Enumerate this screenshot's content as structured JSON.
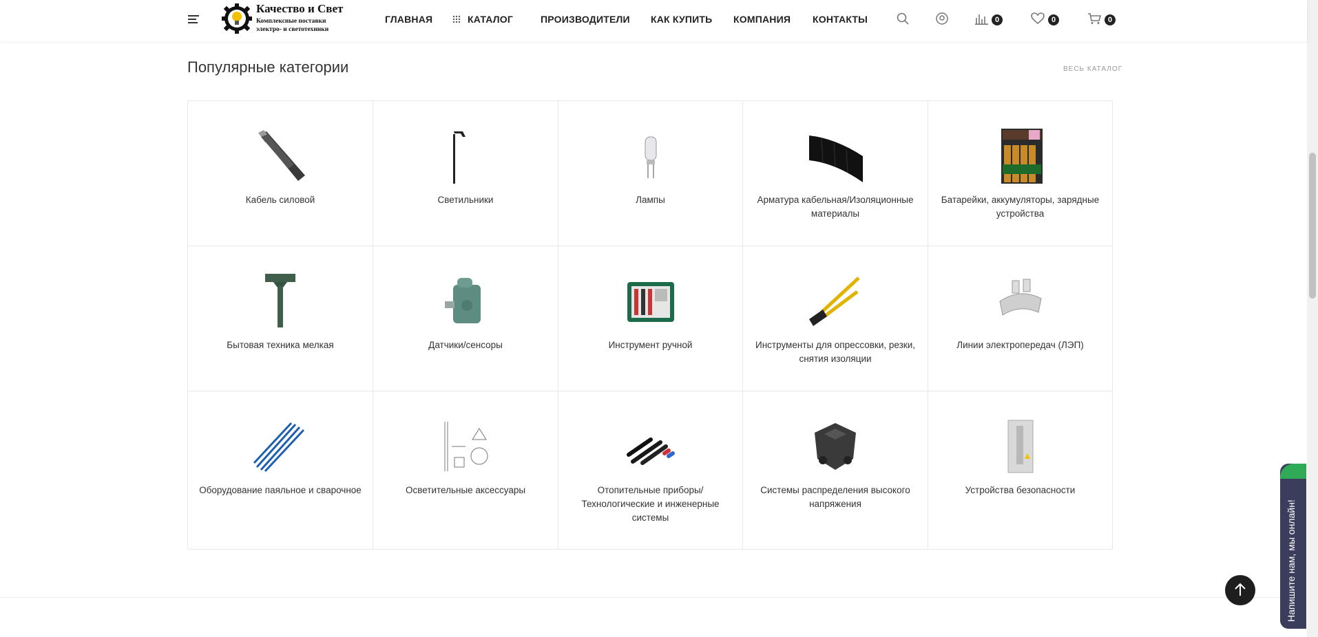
{
  "header": {
    "logo": {
      "title": "Качество и Свет",
      "subtitle_line1": "Комплексные поставки",
      "subtitle_line2": "электро- и светотехники"
    },
    "nav": [
      "ГЛАВНАЯ",
      "КАТАЛОГ",
      "ПРОИЗВОДИТЕЛИ",
      "КАК КУПИТЬ",
      "КОМПАНИЯ",
      "КОНТАКТЫ"
    ],
    "compare_count": "0",
    "favorites_count": "0",
    "cart_count": "0"
  },
  "section": {
    "title": "Популярные категории",
    "all_link": "ВЕСЬ КАТАЛОГ"
  },
  "categories": [
    {
      "label": "Кабель силовой",
      "icon": "power-cable-icon"
    },
    {
      "label": "Светильники",
      "icon": "street-lamp-icon"
    },
    {
      "label": "Лампы",
      "icon": "halogen-bulb-icon"
    },
    {
      "label": "Арматура кабельная/Изоляционные материалы",
      "icon": "insulation-tape-icon"
    },
    {
      "label": "Батарейки, аккумуляторы, зарядные устройства",
      "icon": "battery-pack-icon"
    },
    {
      "label": "Бытовая техника мелкая",
      "icon": "garden-device-icon"
    },
    {
      "label": "Датчики/сенсоры",
      "icon": "limit-switch-icon"
    },
    {
      "label": "Инструмент ручной",
      "icon": "tool-case-icon"
    },
    {
      "label": "Инструменты для опрессовки, резки, снятия изоляции",
      "icon": "crimping-tool-icon"
    },
    {
      "label": "Линии электропередач (ЛЭП)",
      "icon": "power-line-clamp-icon"
    },
    {
      "label": "Оборудование паяльное и сварочное",
      "icon": "soldering-tips-icon"
    },
    {
      "label": "Осветительные аксессуары",
      "icon": "lighting-drawing-icon"
    },
    {
      "label": "Отопительные приборы/ Технологические и инженерные системы",
      "icon": "heat-shrink-tubes-icon"
    },
    {
      "label": "Системы распределения высокого напряжения",
      "icon": "hv-connector-icon"
    },
    {
      "label": "Устройства безопасности",
      "icon": "voltage-tester-icon"
    }
  ],
  "chat": {
    "label": "Напишите нам, мы онлайн!"
  },
  "colors": {
    "accent_green": "#2faa56",
    "chat_bg": "#3a3d5c",
    "dark": "#1e1e1e"
  }
}
